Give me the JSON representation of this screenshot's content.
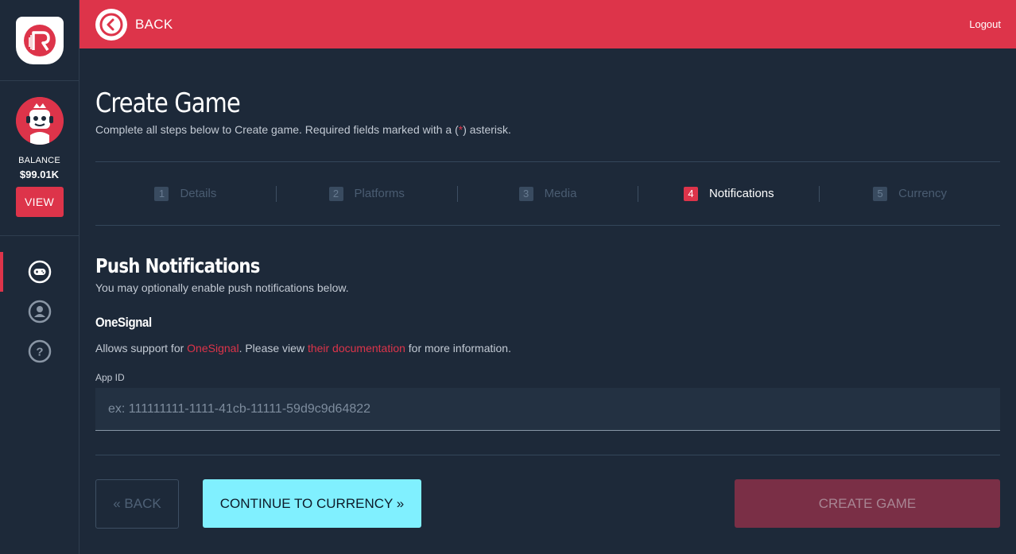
{
  "colors": {
    "accent": "#dd344a",
    "background": "#1d2939",
    "continue_button": "#80f0ff"
  },
  "sidebar": {
    "logo_icon": "brand-logo-icon",
    "avatar_icon": "robot-avatar-icon",
    "balance_label": "BALANCE",
    "balance_value": "$99.01K",
    "view_label": "VIEW",
    "nav": [
      {
        "icon": "gamepad-icon",
        "active": true
      },
      {
        "icon": "user-icon",
        "active": false
      },
      {
        "icon": "help-icon",
        "active": false
      }
    ]
  },
  "topbar": {
    "back_label": "BACK",
    "logout_label": "Logout"
  },
  "page": {
    "title": "Create Game",
    "subtitle_pre": "Complete all steps below to Create game. Required fields marked with a (",
    "subtitle_mark": "*",
    "subtitle_post": ") asterisk."
  },
  "steps": [
    {
      "num": "1",
      "label": "Details",
      "active": false
    },
    {
      "num": "2",
      "label": "Platforms",
      "active": false
    },
    {
      "num": "3",
      "label": "Media",
      "active": false
    },
    {
      "num": "4",
      "label": "Notifications",
      "active": true
    },
    {
      "num": "5",
      "label": "Currency",
      "active": false
    }
  ],
  "section": {
    "title": "Push Notifications",
    "subtitle": "You may optionally enable push notifications below."
  },
  "provider": {
    "title": "OneSignal",
    "desc_pre": "Allows support for ",
    "desc_link1": "OneSignal",
    "desc_mid": ". Please view ",
    "desc_link2": "their documentation",
    "desc_post": " for more information."
  },
  "app_id": {
    "label": "App ID",
    "value": "",
    "placeholder": "ex: 111111111-1111-41cb-11111-59d9c9d64822"
  },
  "actions": {
    "back_label": "« BACK",
    "continue_label": "CONTINUE TO CURRENCY »",
    "create_label": "CREATE GAME"
  }
}
